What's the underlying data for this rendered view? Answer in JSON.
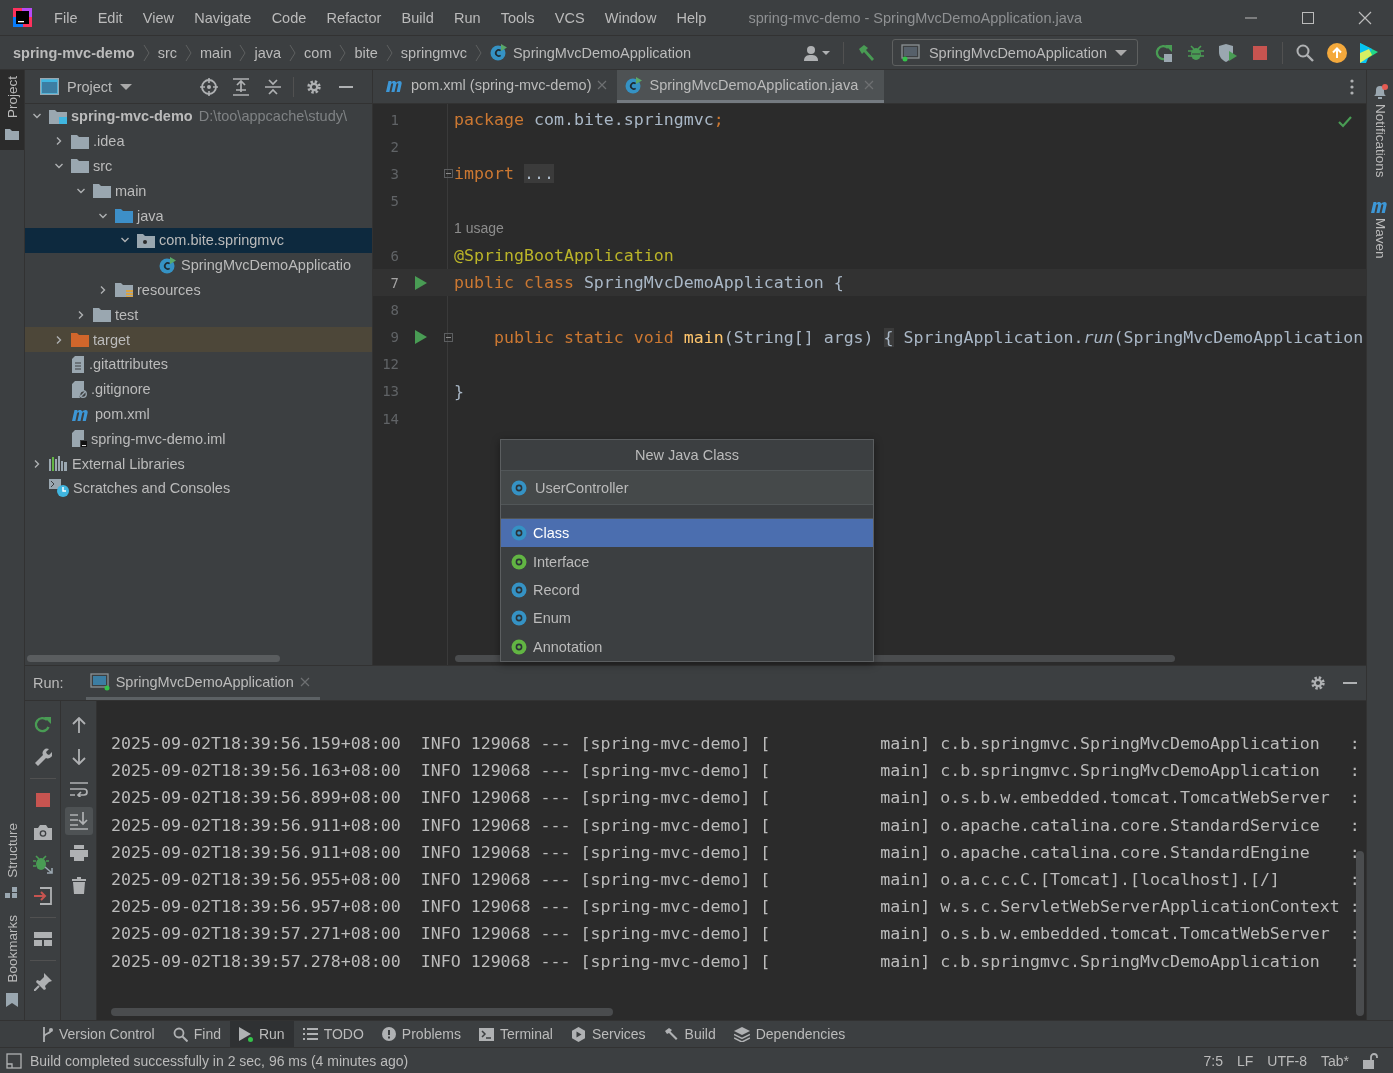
{
  "window": {
    "title": "spring-mvc-demo - SpringMvcDemoApplication.java",
    "menus": [
      "File",
      "Edit",
      "View",
      "Navigate",
      "Code",
      "Refactor",
      "Build",
      "Run",
      "Tools",
      "VCS",
      "Window",
      "Help"
    ]
  },
  "breadcrumbs": [
    {
      "label": "spring-mvc-demo",
      "kind": "project"
    },
    {
      "label": "src",
      "kind": "dir"
    },
    {
      "label": "main",
      "kind": "dir"
    },
    {
      "label": "java",
      "kind": "dir"
    },
    {
      "label": "com",
      "kind": "dir"
    },
    {
      "label": "bite",
      "kind": "dir"
    },
    {
      "label": "springmvc",
      "kind": "dir"
    },
    {
      "label": "SpringMvcDemoApplication",
      "kind": "class"
    }
  ],
  "run_config": "SpringMvcDemoApplication",
  "left_stripe": [
    {
      "label": "Project",
      "selected": true
    },
    {
      "label": "Structure",
      "selected": false
    },
    {
      "label": "Bookmarks",
      "selected": false
    }
  ],
  "right_stripe": [
    {
      "label": "Notifications",
      "kind": "notifications"
    },
    {
      "label": "Maven",
      "kind": "maven"
    }
  ],
  "project": {
    "title": "Project",
    "tree": [
      {
        "label": "spring-mvc-demo",
        "detail": "D:\\too\\appcache\\study\\",
        "kind": "module",
        "expanded": true,
        "selected": false,
        "children": [
          {
            "label": ".idea",
            "kind": "folder",
            "expanded": false,
            "selected": false
          },
          {
            "label": "src",
            "kind": "folder",
            "expanded": true,
            "selected": false,
            "children": [
              {
                "label": "main",
                "kind": "folder",
                "expanded": true,
                "selected": false,
                "children": [
                  {
                    "label": "java",
                    "kind": "source-folder",
                    "expanded": true,
                    "selected": false,
                    "children": [
                      {
                        "label": "com.bite.springmvc",
                        "kind": "package",
                        "expanded": true,
                        "selected": true,
                        "children": [
                          {
                            "label": "SpringMvcDemoApplicatio",
                            "kind": "class",
                            "selected": false
                          }
                        ]
                      }
                    ]
                  },
                  {
                    "label": "resources",
                    "kind": "resources-folder",
                    "expanded": false,
                    "selected": false
                  }
                ]
              },
              {
                "label": "test",
                "kind": "folder",
                "expanded": false,
                "selected": false
              }
            ]
          },
          {
            "label": "target",
            "kind": "excluded-folder",
            "expanded": false,
            "selected": false
          },
          {
            "label": ".gitattributes",
            "kind": "text-file",
            "selected": false
          },
          {
            "label": ".gitignore",
            "kind": "ignore-file",
            "selected": false
          },
          {
            "label": "pom.xml",
            "kind": "maven",
            "selected": false
          },
          {
            "label": "spring-mvc-demo.iml",
            "kind": "module-file",
            "selected": false
          }
        ]
      },
      {
        "label": "External Libraries",
        "kind": "libraries",
        "expanded": false,
        "selected": false
      },
      {
        "label": "Scratches and Consoles",
        "kind": "scratches",
        "selected": false
      }
    ]
  },
  "editor": {
    "tabs": [
      {
        "label": "pom.xml (spring-mvc-demo)",
        "kind": "maven",
        "selected": false
      },
      {
        "label": "SpringMvcDemoApplication.java",
        "kind": "class",
        "selected": true
      }
    ],
    "lines": [
      {
        "kind": "code",
        "number": "1",
        "run": false,
        "fold": false,
        "current": false,
        "tokens": [
          {
            "kind": "keyword",
            "text": "package "
          },
          {
            "kind": "plain",
            "text": "com.bite.springmvc"
          },
          {
            "kind": "keyword",
            "text": ";"
          }
        ]
      },
      {
        "kind": "code",
        "number": "2",
        "run": false,
        "fold": false,
        "current": false
      },
      {
        "kind": "code",
        "number": "3",
        "run": false,
        "fold": true,
        "current": false,
        "tokens": [
          {
            "kind": "keyword",
            "text": "import "
          },
          {
            "kind": "folded",
            "text": "..."
          }
        ]
      },
      {
        "kind": "code",
        "number": "5",
        "run": false,
        "fold": false,
        "current": false
      },
      {
        "kind": "hint",
        "text": "1 usage"
      },
      {
        "kind": "code",
        "number": "6",
        "run": false,
        "fold": false,
        "current": false,
        "tokens": [
          {
            "kind": "annotation",
            "text": "@SpringBootApplication"
          }
        ]
      },
      {
        "kind": "code",
        "number": "7",
        "run": true,
        "fold": false,
        "current": true,
        "tokens": [
          {
            "kind": "keyword",
            "text": "public class "
          },
          {
            "kind": "plain",
            "text": "SpringMvcDemoApplication {"
          }
        ]
      },
      {
        "kind": "code",
        "number": "8",
        "run": false,
        "fold": false,
        "current": false
      },
      {
        "kind": "code",
        "number": "9",
        "run": true,
        "fold": true,
        "current": false,
        "tokens": [
          {
            "kind": "keyword",
            "text": "    public static void "
          },
          {
            "kind": "method",
            "text": "main"
          },
          {
            "kind": "plain",
            "text": "(String[] args) "
          },
          {
            "kind": "folded",
            "text": "{"
          },
          {
            "kind": "plain",
            "text": " SpringApplication."
          },
          {
            "kind": "italic",
            "text": "run"
          },
          {
            "kind": "plain",
            "text": "(SpringMvcDemoApplication"
          }
        ]
      },
      {
        "kind": "code",
        "number": "12",
        "run": false,
        "fold": false,
        "current": false
      },
      {
        "kind": "code",
        "number": "13",
        "run": false,
        "fold": false,
        "current": false,
        "tokens": [
          {
            "kind": "plain",
            "text": "}"
          }
        ]
      },
      {
        "kind": "code",
        "number": "14",
        "run": false,
        "fold": false,
        "current": false
      }
    ]
  },
  "popup": {
    "title": "New Java Class",
    "value": "UserController",
    "options": [
      {
        "label": "Class",
        "kind": "class",
        "selected": true
      },
      {
        "label": "Interface",
        "kind": "interface",
        "selected": false
      },
      {
        "label": "Record",
        "kind": "record",
        "selected": false
      },
      {
        "label": "Enum",
        "kind": "enum",
        "selected": false
      },
      {
        "label": "Annotation",
        "kind": "annotation",
        "selected": false
      }
    ]
  },
  "run": {
    "label": "Run:",
    "tab": "SpringMvcDemoApplication",
    "scroll_to_end_on": true,
    "lines": [
      "2025-09-02T18:39:56.159+08:00  INFO 129068 --- [spring-mvc-demo] [           main] c.b.springmvc.SpringMvcDemoApplication   :",
      "2025-09-02T18:39:56.163+08:00  INFO 129068 --- [spring-mvc-demo] [           main] c.b.springmvc.SpringMvcDemoApplication   :",
      "2025-09-02T18:39:56.899+08:00  INFO 129068 --- [spring-mvc-demo] [           main] o.s.b.w.embedded.tomcat.TomcatWebServer  :",
      "2025-09-02T18:39:56.911+08:00  INFO 129068 --- [spring-mvc-demo] [           main] o.apache.catalina.core.StandardService   :",
      "2025-09-02T18:39:56.911+08:00  INFO 129068 --- [spring-mvc-demo] [           main] o.apache.catalina.core.StandardEngine    :",
      "2025-09-02T18:39:56.955+08:00  INFO 129068 --- [spring-mvc-demo] [           main] o.a.c.c.C.[Tomcat].[localhost].[/]       :",
      "2025-09-02T18:39:56.957+08:00  INFO 129068 --- [spring-mvc-demo] [           main] w.s.c.ServletWebServerApplicationContext :",
      "2025-09-02T18:39:57.271+08:00  INFO 129068 --- [spring-mvc-demo] [           main] o.s.b.w.embedded.tomcat.TomcatWebServer  :",
      "2025-09-02T18:39:57.278+08:00  INFO 129068 --- [spring-mvc-demo] [           main] c.b.springmvc.SpringMvcDemoApplication   :"
    ]
  },
  "tool_windows": [
    {
      "label": "Version Control",
      "kind": "vcs",
      "selected": false
    },
    {
      "label": "Find",
      "kind": "find",
      "selected": false
    },
    {
      "label": "Run",
      "kind": "run",
      "selected": true
    },
    {
      "label": "TODO",
      "kind": "todo",
      "selected": false
    },
    {
      "label": "Problems",
      "kind": "problems",
      "selected": false
    },
    {
      "label": "Terminal",
      "kind": "terminal",
      "selected": false
    },
    {
      "label": "Services",
      "kind": "services",
      "selected": false
    },
    {
      "label": "Build",
      "kind": "build",
      "selected": false
    },
    {
      "label": "Dependencies",
      "kind": "dependencies",
      "selected": false
    }
  ],
  "status_bar": {
    "message": "Build completed successfully in 2 sec, 96 ms (4 minutes ago)",
    "position": "7:5",
    "line_separator": "LF",
    "encoding": "UTF-8",
    "indent": "Tab*"
  }
}
